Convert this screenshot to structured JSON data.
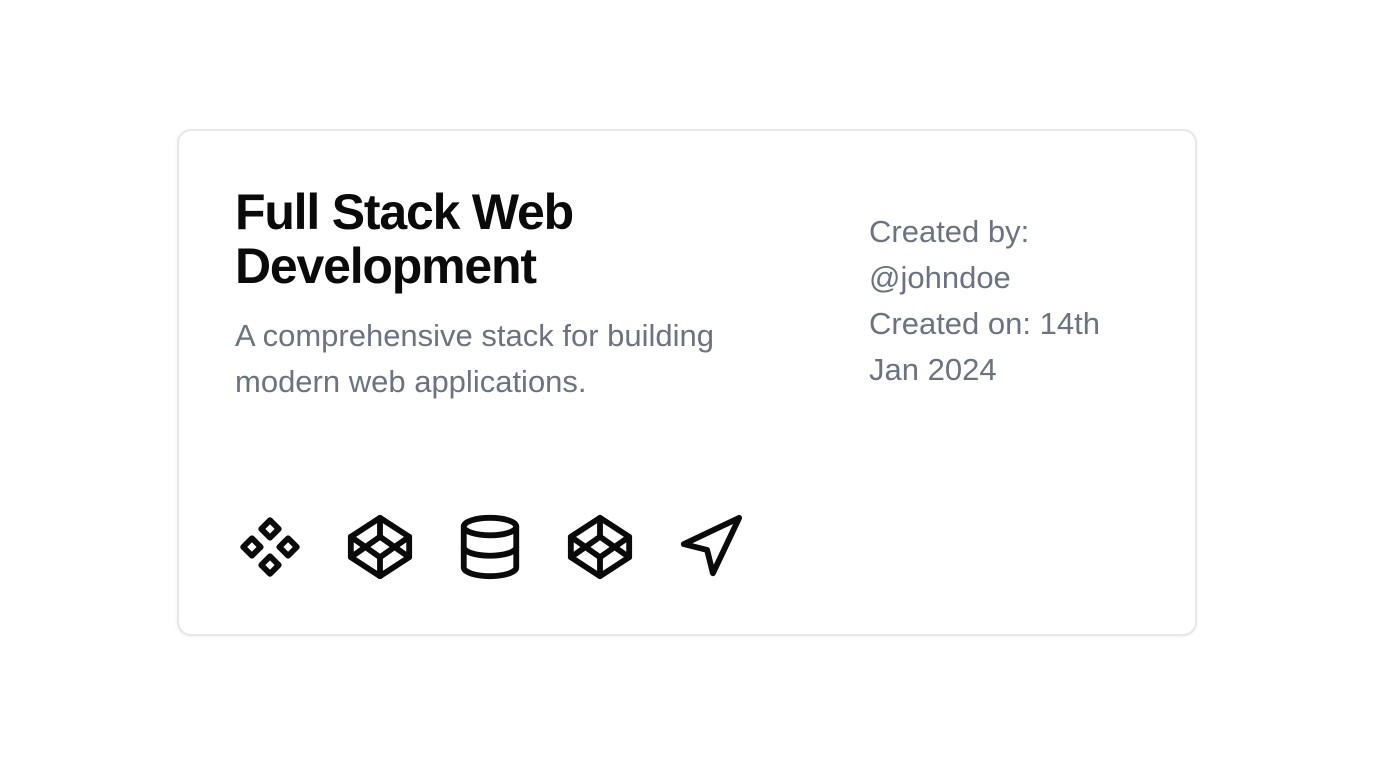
{
  "card": {
    "title": "Full Stack Web Development",
    "description": "A comprehensive stack for building modern web applications.",
    "created_by_label": "Created by:",
    "created_by_value": "@johndoe",
    "created_on_label": "Created on: 14th",
    "created_on_value": "Jan 2024"
  },
  "icons": [
    "components-icon",
    "codepen-icon",
    "database-icon",
    "codepen-icon",
    "navigation-arrow-icon"
  ],
  "colors": {
    "title": "#0a0a0a",
    "muted_text": "#6b7280",
    "border": "#e5e7eb",
    "icon_stroke": "#0a0a0a"
  }
}
